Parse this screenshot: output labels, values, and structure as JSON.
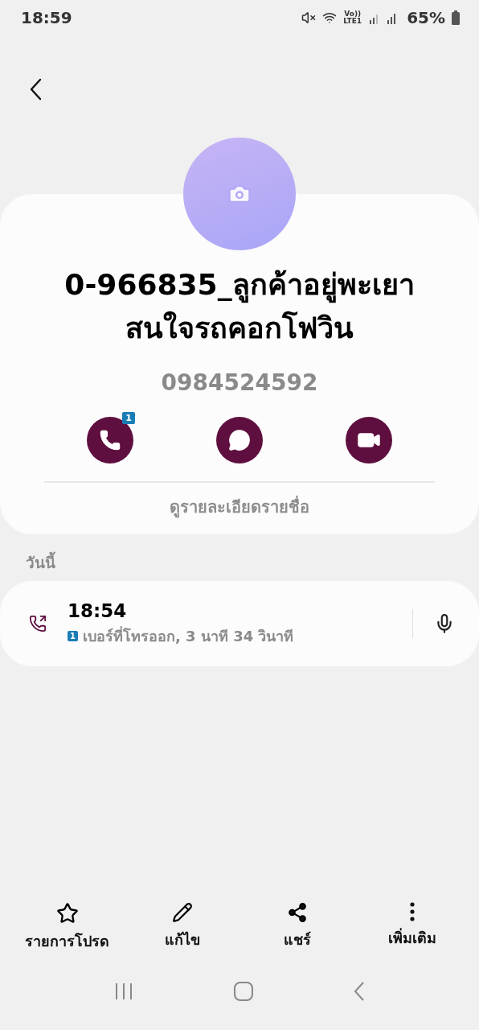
{
  "status_bar": {
    "time": "18:59",
    "network_top": "Vo))",
    "network_bottom": "LTE1",
    "battery": "65%"
  },
  "contact": {
    "name": "0-966835_ลูกค้าอยู่พะเยา สนใจรถคอกโฟวิน",
    "phone": "0984524592"
  },
  "actions": [
    {
      "kind": "call",
      "badge": "1"
    },
    {
      "kind": "message"
    },
    {
      "kind": "video"
    }
  ],
  "details_link": "ดูรายละเอียดรายชื่อ",
  "history": {
    "section": "วันนี้",
    "entries": [
      {
        "time": "18:54",
        "sim": "1",
        "description": "เบอร์ที่โทรออก, 3 นาที 34 วินาที"
      }
    ]
  },
  "bottom_bar": [
    {
      "kind": "favorite",
      "label": "รายการโปรด"
    },
    {
      "kind": "edit",
      "label": "แก้ไข"
    },
    {
      "kind": "share",
      "label": "แชร์"
    },
    {
      "kind": "more",
      "label": "เพิ่มเติม"
    }
  ]
}
